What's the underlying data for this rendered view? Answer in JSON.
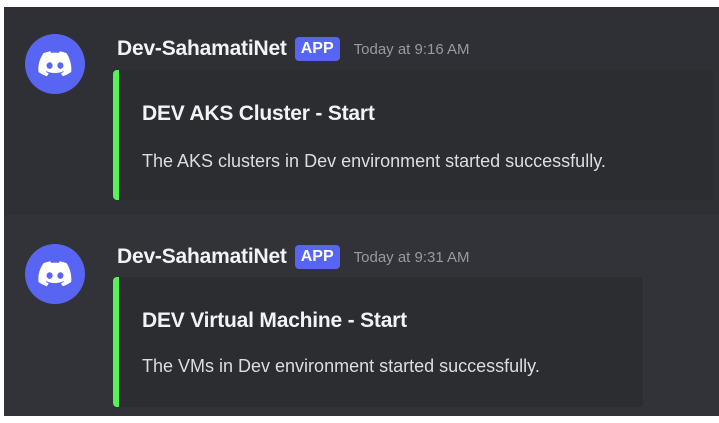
{
  "messages": [
    {
      "author": "Dev-SahamatiNet",
      "tag": "APP",
      "timestamp": "Today at 9:16 AM",
      "avatar_icon": "discord-logo-icon",
      "embed": {
        "title": "DEV AKS Cluster - Start",
        "description": "The AKS clusters in Dev environment started successfully.",
        "accent_color": "#57f257"
      }
    },
    {
      "author": "Dev-SahamatiNet",
      "tag": "APP",
      "timestamp": "Today at 9:31 AM",
      "avatar_icon": "discord-logo-icon",
      "embed": {
        "title": "DEV Virtual Machine - Start",
        "description": "The VMs in Dev environment started successfully.",
        "accent_color": "#57f257"
      }
    }
  ],
  "colors": {
    "background": "#313338",
    "hover_background": "#2e3035",
    "embed_background": "#2b2d31",
    "avatar": "#5865f2",
    "app_tag": "#5865f2",
    "author_text": "#f2f3f5",
    "timestamp_text": "#949ba4"
  }
}
